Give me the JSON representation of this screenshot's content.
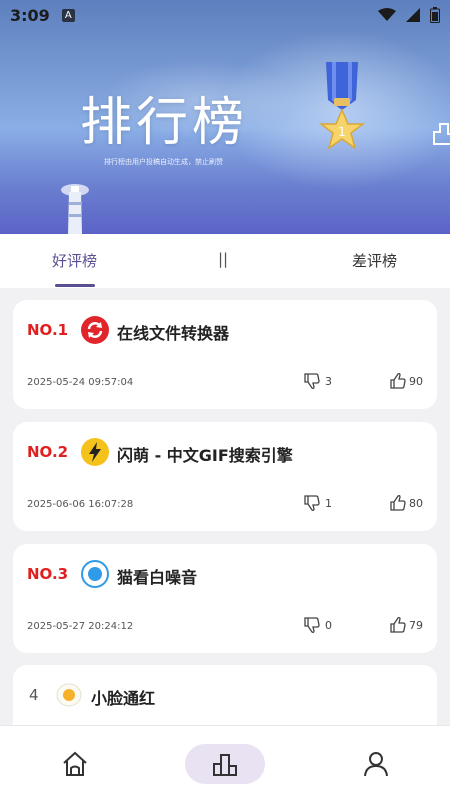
{
  "status_bar": {
    "time": "3:09",
    "notification_glyph": "A"
  },
  "banner": {
    "title": "排行榜",
    "subtitle": "排行榜由用户投稿自动生成，禁止刷赞"
  },
  "tabs": {
    "good": "好评榜",
    "middle": "||",
    "bad": "差评榜"
  },
  "items": [
    {
      "rank": "NO.1",
      "name": "在线文件转换器",
      "date": "2025-05-24 09:57:04",
      "dislikes": "3",
      "likes": "90",
      "icon": "refresh-icon",
      "icon_color": "#e0262b"
    },
    {
      "rank": "NO.2",
      "name": "闪萌 - 中文GIF搜索引擎",
      "date": "2025-06-06 16:07:28",
      "dislikes": "1",
      "likes": "80",
      "icon": "lightning-icon",
      "icon_color": "#f5c21b"
    },
    {
      "rank": "NO.3",
      "name": "猫看白噪音",
      "date": "2025-05-27 20:24:12",
      "dislikes": "0",
      "likes": "79",
      "icon": "circle-icon",
      "icon_color": "#2f9be8"
    },
    {
      "rank": "4",
      "name": "小脸通红",
      "icon": "egg-icon",
      "icon_color": "#f5b12a"
    }
  ],
  "colors": {
    "accent": "#5b4f93",
    "rank_red": "#e02020",
    "nav_active_bg": "#e9e2f3"
  }
}
